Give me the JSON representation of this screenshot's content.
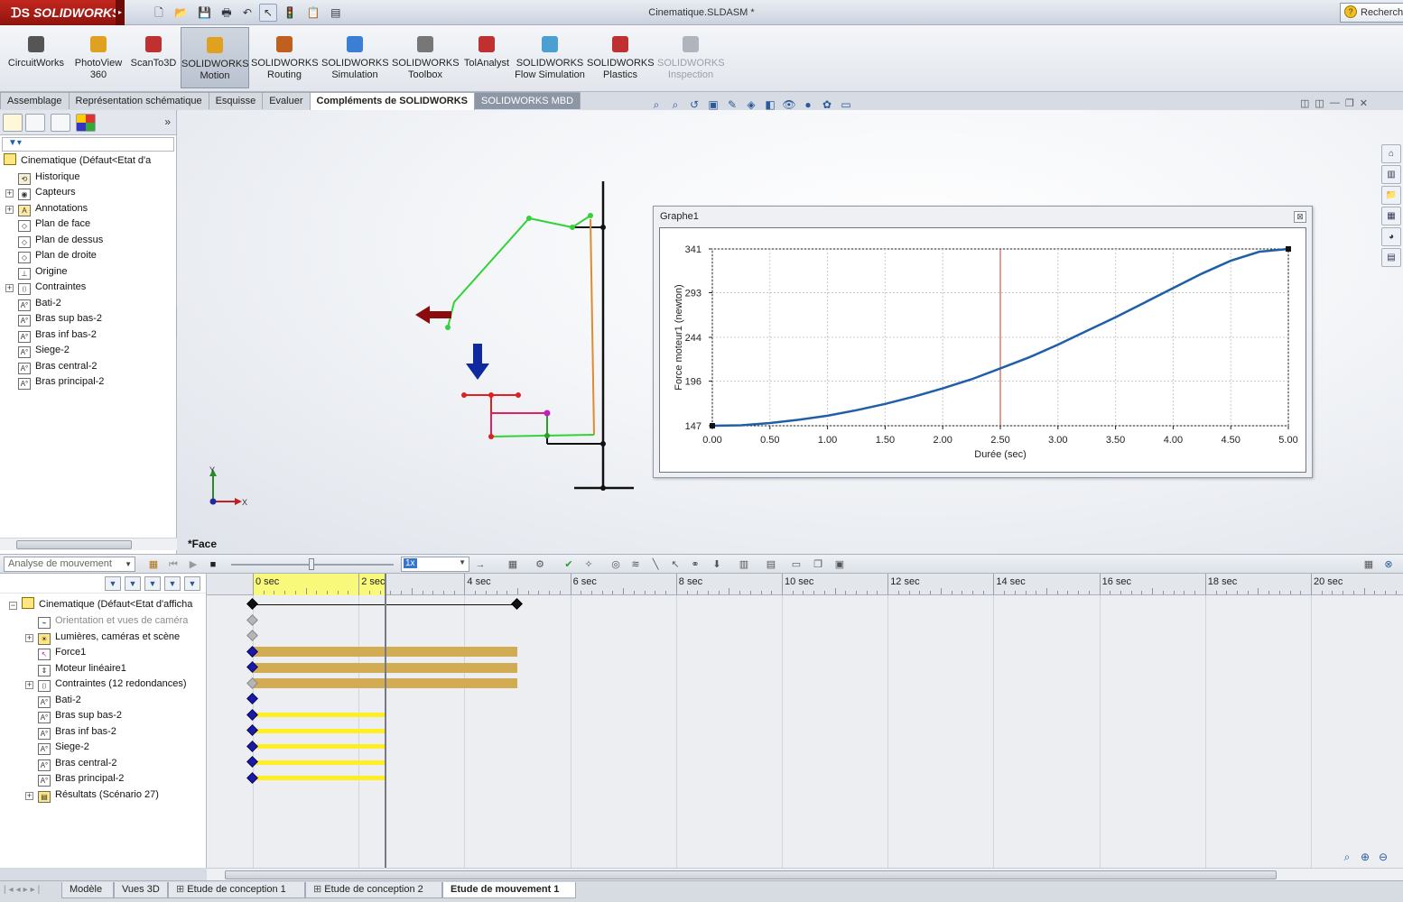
{
  "app": {
    "brand": "SOLIDWORKS",
    "document_title": "Cinematique.SLDASM *",
    "search_label": "Recherch"
  },
  "ribbon": {
    "buttons": [
      {
        "label": "CircuitWorks",
        "state": "normal",
        "color": "#555555"
      },
      {
        "label": "PhotoView 360",
        "state": "normal",
        "color": "#e0a020"
      },
      {
        "label": "ScanTo3D",
        "state": "normal",
        "color": "#c03030"
      },
      {
        "label": "SOLIDWORKS Motion",
        "state": "active",
        "color": "#e0a020"
      },
      {
        "label": "SOLIDWORKS Routing",
        "state": "normal",
        "color": "#c06020"
      },
      {
        "label": "SOLIDWORKS Simulation",
        "state": "normal",
        "color": "#3a7fd5"
      },
      {
        "label": "SOLIDWORKS Toolbox",
        "state": "normal",
        "color": "#777777"
      },
      {
        "label": "TolAnalyst",
        "state": "normal",
        "color": "#c03030"
      },
      {
        "label": "SOLIDWORKS Flow Simulation",
        "state": "normal",
        "color": "#4aa0d0"
      },
      {
        "label": "SOLIDWORKS Plastics",
        "state": "normal",
        "color": "#c03030"
      },
      {
        "label": "SOLIDWORKS Inspection",
        "state": "disabled",
        "color": "#b0b5bd"
      }
    ]
  },
  "command_tabs": [
    "Assemblage",
    "Représentation schématique",
    "Esquisse",
    "Evaluer",
    "Compléments de SOLIDWORKS",
    "SOLIDWORKS MBD"
  ],
  "command_tab_active": "Compléments de SOLIDWORKS",
  "feature_tree": {
    "root": "Cinematique  (Défaut<Etat d'a",
    "items": [
      {
        "label": "Historique",
        "icon": "history-icon",
        "expandable": false
      },
      {
        "label": "Capteurs",
        "icon": "sensor-icon",
        "expandable": true
      },
      {
        "label": "Annotations",
        "icon": "annotation-icon",
        "expandable": true
      },
      {
        "label": "Plan de face",
        "icon": "plane-icon",
        "expandable": false
      },
      {
        "label": "Plan de dessus",
        "icon": "plane-icon",
        "expandable": false
      },
      {
        "label": "Plan de droite",
        "icon": "plane-icon",
        "expandable": false
      },
      {
        "label": "Origine",
        "icon": "origin-icon",
        "expandable": false
      },
      {
        "label": "Contraintes",
        "icon": "mates-icon",
        "expandable": true
      },
      {
        "label": "Bati-2",
        "icon": "part-icon",
        "expandable": false
      },
      {
        "label": "Bras sup bas-2",
        "icon": "part-icon",
        "expandable": false
      },
      {
        "label": "Bras inf bas-2",
        "icon": "part-icon",
        "expandable": false
      },
      {
        "label": "Siege-2",
        "icon": "part-icon",
        "expandable": false
      },
      {
        "label": "Bras central-2",
        "icon": "part-icon",
        "expandable": false
      },
      {
        "label": "Bras principal-2",
        "icon": "part-icon",
        "expandable": false
      }
    ]
  },
  "viewport": {
    "view_label": "*Face",
    "triad": {
      "x": "X",
      "y": "Y"
    }
  },
  "graph": {
    "window_title": "Graphe1",
    "close_glyph": "⊠"
  },
  "chart_data": {
    "type": "line",
    "title": "",
    "xlabel": "Durée (sec)",
    "ylabel": "Force moteur1  (newton)",
    "xlim": [
      0,
      5
    ],
    "ylim": [
      147,
      341
    ],
    "x_ticks": [
      "0.00",
      "0.50",
      "1.00",
      "1.50",
      "2.00",
      "2.50",
      "3.00",
      "3.50",
      "4.00",
      "4.50",
      "5.00"
    ],
    "y_ticks": [
      "147",
      "196",
      "244",
      "293",
      "341"
    ],
    "grid": true,
    "marker_x": 2.5,
    "series": [
      {
        "color": "#1f5fa8",
        "x": [
          0,
          0.25,
          0.5,
          0.75,
          1.0,
          1.25,
          1.5,
          1.75,
          2.0,
          2.25,
          2.5,
          2.75,
          3.0,
          3.25,
          3.5,
          3.75,
          4.0,
          4.25,
          4.5,
          4.75,
          5.0
        ],
        "y": [
          147,
          147.5,
          150,
          153.5,
          158,
          164,
          171,
          179,
          188,
          198,
          210,
          222,
          236,
          251,
          266,
          282,
          298,
          314,
          328,
          338,
          341
        ]
      }
    ]
  },
  "motion_manager": {
    "study_type": "Analyse de mouvement",
    "speed": "1x",
    "tree_root": "Cinematique  (Défaut<Etat d'afficha",
    "items": [
      {
        "label": "Orientation et vues de caméra",
        "dim": true,
        "expandable": false,
        "icon": "camera-icon"
      },
      {
        "label": "Lumières, caméras et scène",
        "dim": false,
        "expandable": true,
        "icon": "lights-icon"
      },
      {
        "label": "Force1",
        "dim": false,
        "expandable": false,
        "icon": "force-icon"
      },
      {
        "label": "Moteur linéaire1",
        "dim": false,
        "expandable": false,
        "icon": "linear-motor-icon"
      },
      {
        "label": "Contraintes (12 redondances)",
        "dim": false,
        "expandable": true,
        "icon": "mates-icon"
      },
      {
        "label": "Bati-2",
        "dim": false,
        "expandable": false,
        "icon": "part-icon"
      },
      {
        "label": "Bras sup bas-2",
        "dim": false,
        "expandable": false,
        "icon": "part-icon"
      },
      {
        "label": "Bras inf bas-2",
        "dim": false,
        "expandable": false,
        "icon": "part-icon"
      },
      {
        "label": "Siege-2",
        "dim": false,
        "expandable": false,
        "icon": "part-icon"
      },
      {
        "label": "Bras central-2",
        "dim": false,
        "expandable": false,
        "icon": "part-icon"
      },
      {
        "label": "Bras principal-2",
        "dim": false,
        "expandable": false,
        "icon": "part-icon"
      },
      {
        "label": "Résultats (Scénario 27)",
        "dim": false,
        "expandable": true,
        "icon": "results-icon"
      }
    ],
    "timeline": {
      "ticks": [
        "0 sec",
        "2 sec",
        "4 sec",
        "6 sec",
        "8 sec",
        "10 sec",
        "12 sec",
        "14 sec",
        "16 sec",
        "18 sec",
        "20 sec"
      ],
      "cursor_sec": 2.5,
      "end_sec": 5
    }
  },
  "bottom_tabs": [
    "Modèle",
    "Vues 3D",
    "Etude de conception 1",
    "Etude de conception 2",
    "Etude de mouvement 1"
  ],
  "bottom_tab_active": "Etude de mouvement 1"
}
